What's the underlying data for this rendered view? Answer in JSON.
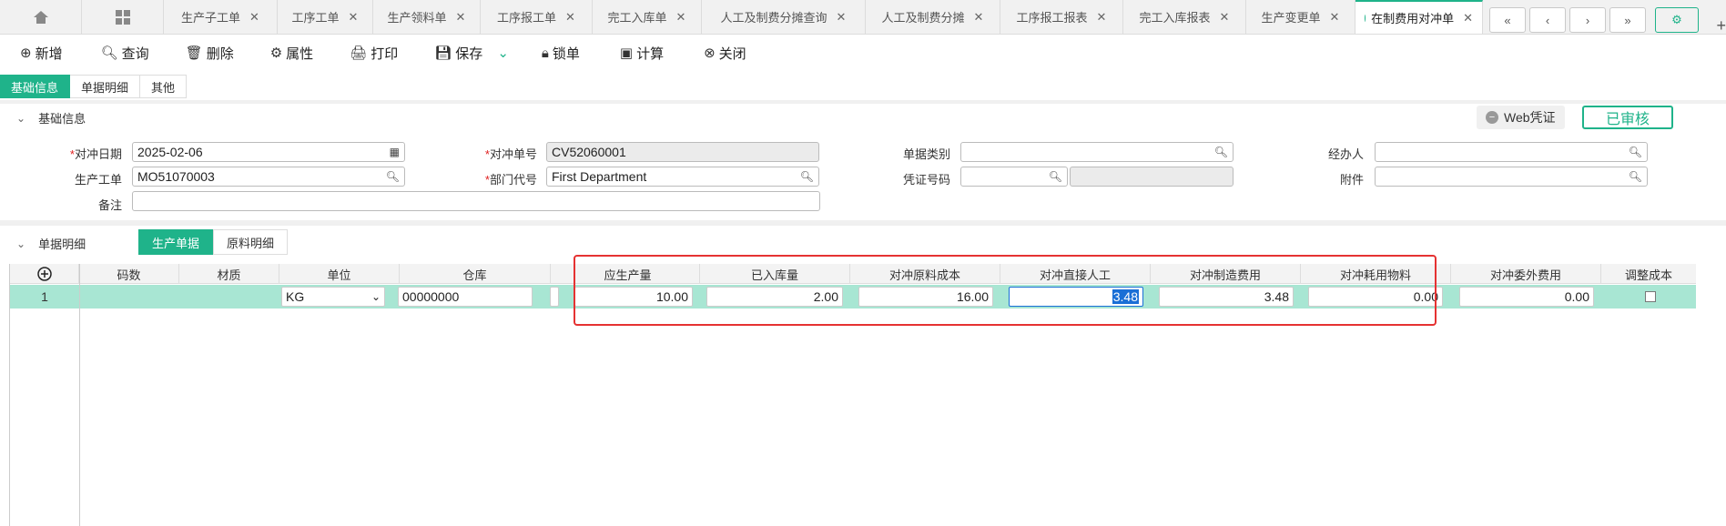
{
  "tabs": [
    {
      "label": "生产子工单"
    },
    {
      "label": "工序工单"
    },
    {
      "label": "生产领料单"
    },
    {
      "label": "工序报工单"
    },
    {
      "label": "完工入库单"
    },
    {
      "label": "人工及制费分摊查询"
    },
    {
      "label": "人工及制费分摊"
    },
    {
      "label": "工序报工报表"
    },
    {
      "label": "完工入库报表"
    },
    {
      "label": "生产变更单"
    },
    {
      "label": "在制费用对冲单"
    }
  ],
  "toolbar": {
    "new": "新增",
    "query": "查询",
    "delete": "删除",
    "props": "属性",
    "print": "打印",
    "save": "保存",
    "lock": "锁单",
    "calc": "计算",
    "close": "关闭"
  },
  "section_tabs": [
    "基础信息",
    "单据明细",
    "其他"
  ],
  "basic_section": {
    "title": "基础信息",
    "web_voucher": "Web凭证",
    "status": "已审核"
  },
  "form": {
    "offset_date": {
      "label": "对冲日期",
      "value": "2025-02-06"
    },
    "offset_no": {
      "label": "对冲单号",
      "value": "CV52060001"
    },
    "doc_category": {
      "label": "单据类别",
      "value": ""
    },
    "handler": {
      "label": "经办人",
      "value": ""
    },
    "work_order": {
      "label": "生产工单",
      "value": "MO51070003"
    },
    "dept_code": {
      "label": "部门代号",
      "value": "First Department"
    },
    "voucher_no": {
      "label": "凭证号码",
      "value": ""
    },
    "attachment": {
      "label": "附件",
      "value": ""
    },
    "remark": {
      "label": "备注",
      "value": ""
    }
  },
  "detail_section": {
    "title": "单据明细",
    "tabs": [
      "生产单据",
      "原料明细"
    ]
  },
  "grid": {
    "headers": [
      "码数",
      "材质",
      "单位",
      "仓库",
      "应生产量",
      "已入库量",
      "对冲原料成本",
      "对冲直接人工",
      "对冲制造费用",
      "对冲耗用物料",
      "对冲委外费用",
      "调整成本"
    ],
    "rows": [
      {
        "row_no": "1",
        "size": "",
        "material": "",
        "unit": "KG",
        "warehouse": "00000000",
        "planned_qty": "10.00",
        "stocked_qty": "2.00",
        "raw_cost": "16.00",
        "direct_labor": "3.48",
        "mfg_overhead": "3.48",
        "consumables": "0.00",
        "outsource": "0.00",
        "adjust_cost": false
      }
    ]
  },
  "colors": {
    "accent": "#1fb38a",
    "row_selected": "#a8e6d3",
    "highlight": "#e53232"
  }
}
